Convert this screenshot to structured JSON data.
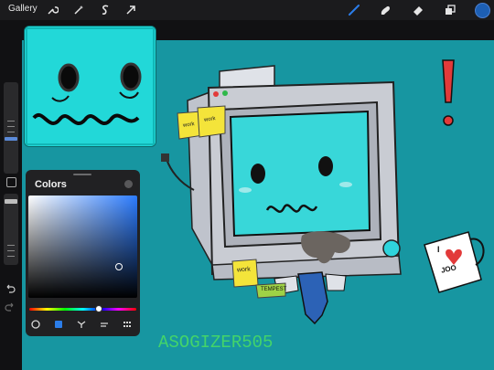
{
  "topbar": {
    "gallery_label": "Gallery",
    "icons": [
      "wrench-icon",
      "magic-wand-icon",
      "selection-s-icon",
      "transform-arrow-icon",
      "brush-icon",
      "smudge-icon",
      "eraser-icon",
      "layers-icon",
      "color-swatch-icon"
    ],
    "active_color": "#1d5fb4",
    "accent": "#2b7de9"
  },
  "colors_panel": {
    "title": "Colors",
    "selected_color": "#2a6fd8",
    "tabs": [
      "disc-tab",
      "classic-tab",
      "harmony-tab",
      "value-tab",
      "palettes-tab"
    ]
  },
  "artwork": {
    "canvas_color": "#1796a1",
    "sticky_notes": [
      "work",
      "work",
      "work",
      "TEMPEST"
    ],
    "mug_text": "I",
    "mug_text2": "JOO",
    "exclamation": "!",
    "signature": "ASOGIZER505"
  }
}
